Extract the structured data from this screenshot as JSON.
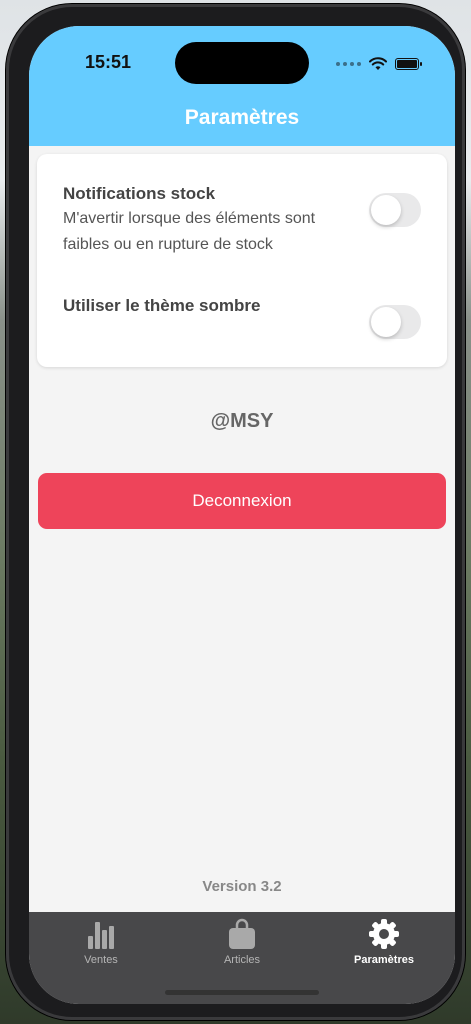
{
  "status_bar": {
    "time": "15:51",
    "icons": [
      "signal-dots-icon",
      "wifi-icon",
      "battery-icon"
    ]
  },
  "header": {
    "title": "Paramètres",
    "background": "#66ccff"
  },
  "settings": [
    {
      "title": "Notifications stock",
      "description": "M'avertir lorsque des éléments sont faibles ou en rupture de stock",
      "enabled": false
    },
    {
      "title": "Utiliser le thème sombre",
      "description": "",
      "enabled": false
    }
  ],
  "user": {
    "handle": "@MSY"
  },
  "logout": {
    "label": "Deconnexion",
    "color": "#ee445a"
  },
  "footer": {
    "version": "Version 3.2"
  },
  "tabs": [
    {
      "label": "Ventes",
      "icon": "bar-chart-icon",
      "active": false
    },
    {
      "label": "Articles",
      "icon": "shopping-bag-icon",
      "active": false
    },
    {
      "label": "Paramètres",
      "icon": "gear-icon",
      "active": true
    }
  ],
  "colors": {
    "tabbar": "#48484a",
    "screen_background": "#f4f4f4"
  }
}
